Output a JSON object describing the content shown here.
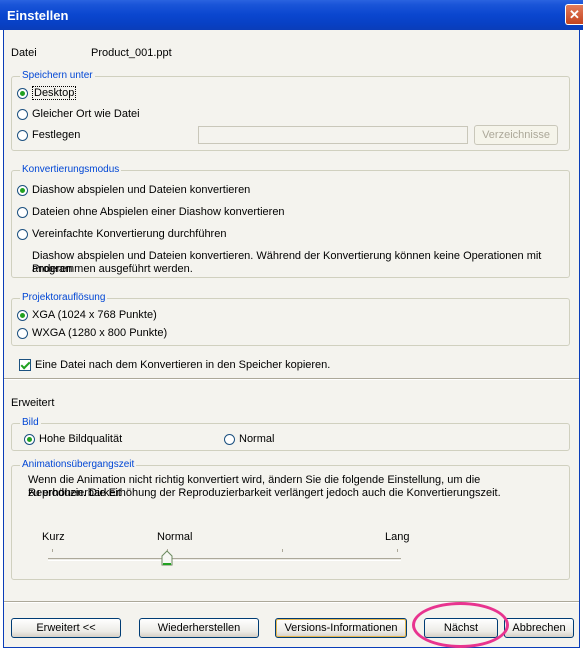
{
  "window": {
    "title": "Einstellen"
  },
  "file": {
    "label": "Datei",
    "name": "Product_001.ppt"
  },
  "save_as": {
    "legend": "Speichern unter",
    "options": [
      "Desktop",
      "Gleicher Ort wie Datei",
      "Festlegen"
    ],
    "selected": 0,
    "folder_button": "Verzeichnisse"
  },
  "conversion": {
    "legend": "Konvertierungsmodus",
    "options": [
      "Diashow abspielen und Dateien konvertieren",
      "Dateien ohne Abspielen einer Diashow konvertieren",
      "Vereinfachte Konvertierung durchführen"
    ],
    "selected": 0,
    "description_line1": "Diashow abspielen und Dateien konvertieren. Während der Konvertierung können keine Operationen mit anderen",
    "description_line2": "Programmen ausgeführt werden."
  },
  "resolution": {
    "legend": "Projektorauflösung",
    "options": [
      "XGA (1024 x 768 Punkte)",
      "WXGA (1280 x 800 Punkte)"
    ],
    "selected": 0
  },
  "copy_checkbox": {
    "label": "Eine Datei nach dem Konvertieren in den Speicher kopieren.",
    "checked": true
  },
  "advanced": {
    "label": "Erweitert",
    "image": {
      "legend": "Bild",
      "options": [
        "Hohe Bildqualität",
        "Normal"
      ],
      "selected": 0
    },
    "animation": {
      "legend": "Animationsübergangszeit",
      "description_line1": "Wenn die Animation nicht richtig konvertiert wird, ändern Sie die folgende Einstellung, um die Reproduzierbarkeit",
      "description_line2": "zu erhöhen. Die Erhöhung der Reproduzierbarkeit verlängert jedoch auch die Konvertierungszeit.",
      "slider_labels": [
        "Kurz",
        "Normal",
        "Lang"
      ],
      "slider_value": "Normal"
    }
  },
  "buttons": {
    "advanced": "Erweitert <<",
    "restore": "Wiederherstellen",
    "version": "Versions-Informationen",
    "next": "Nächst",
    "cancel": "Abbrechen"
  },
  "colors": {
    "titlebar": "#0a46cf",
    "legend": "#0046d5",
    "highlight": "#e8348f",
    "radio_dot": "#21a121"
  }
}
